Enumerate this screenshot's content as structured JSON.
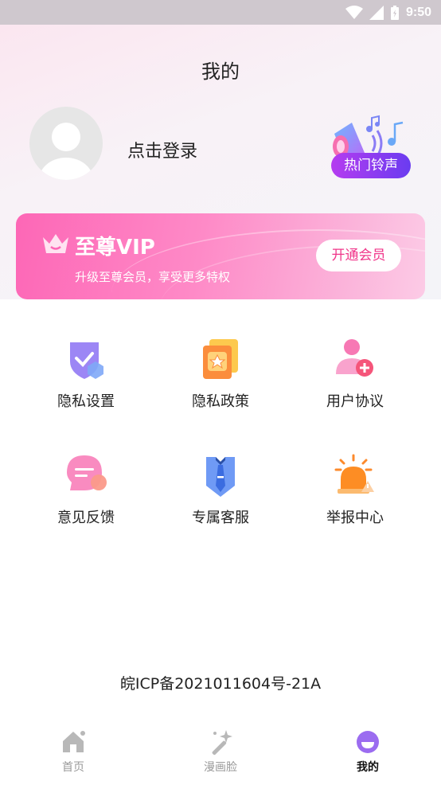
{
  "status_bar": {
    "time": "9:50"
  },
  "header": {
    "title": "我的"
  },
  "profile": {
    "login_text": "点击登录",
    "ringtone_label": "热门铃声"
  },
  "vip": {
    "title": "至尊VIP",
    "subtitle": "升级至尊会员，享受更多特权",
    "button": "开通会员"
  },
  "menu": [
    {
      "label": "隐私设置",
      "icon": "shield-check-icon"
    },
    {
      "label": "隐私政策",
      "icon": "policy-card-icon"
    },
    {
      "label": "用户协议",
      "icon": "user-add-icon"
    },
    {
      "label": "意见反馈",
      "icon": "chat-bubble-icon"
    },
    {
      "label": "专属客服",
      "icon": "tie-icon"
    },
    {
      "label": "举报中心",
      "icon": "alarm-icon"
    }
  ],
  "footer": {
    "icp": "皖ICP备2021011604号-21A"
  },
  "tabs": [
    {
      "label": "首页",
      "icon": "home-icon"
    },
    {
      "label": "漫画脸",
      "icon": "magic-wand-icon"
    },
    {
      "label": "我的",
      "icon": "smile-icon",
      "active": true
    }
  ],
  "colors": {
    "accent": "#f0368a",
    "vip_gradient_start": "#fd67b6",
    "tab_active": "#9b6cf0"
  }
}
